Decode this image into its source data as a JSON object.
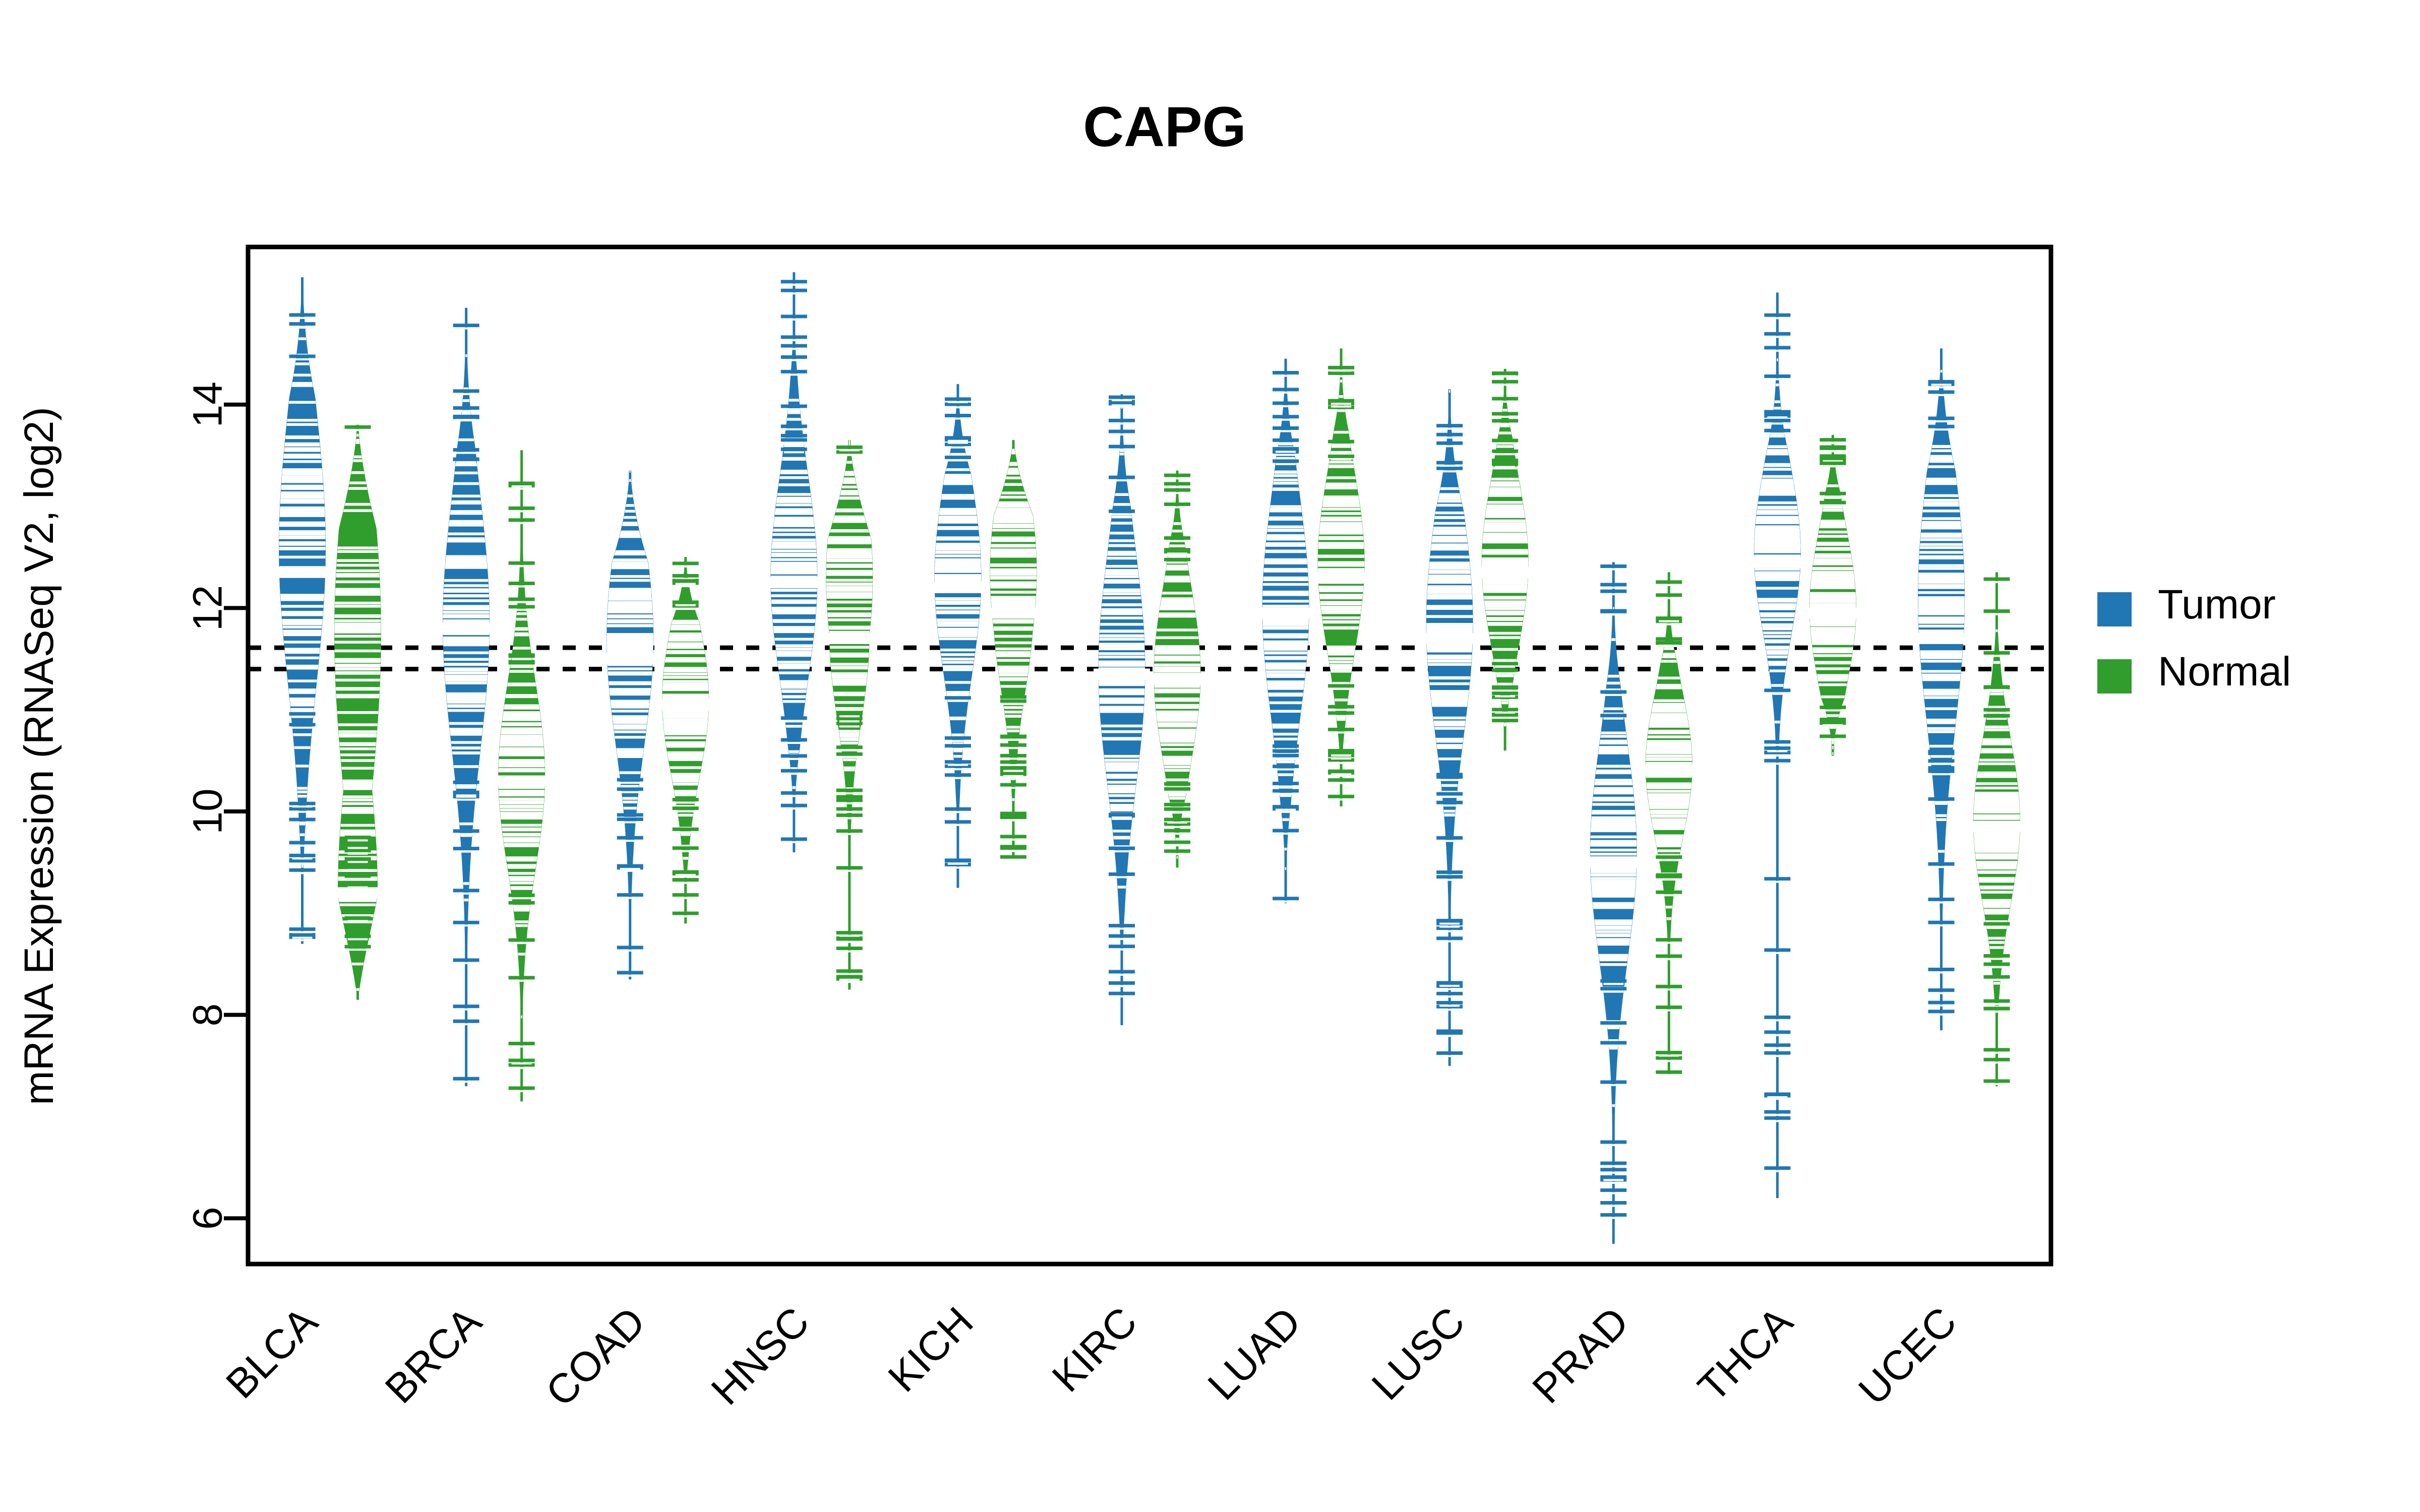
{
  "chart_data": {
    "type": "violin",
    "title": "CAPG",
    "xlabel": "",
    "ylabel": "mRNA Expression (RNASeq V2, log2)",
    "ylim": [
      5.55,
      15.55
    ],
    "yticks": [
      6,
      8,
      10,
      12,
      14
    ],
    "ytick_labels": [
      "6",
      "8",
      "10",
      "12",
      "14"
    ],
    "grid": false,
    "legend_position": "right",
    "categories": [
      "BLCA",
      "BRCA",
      "COAD",
      "HNSC",
      "KICH",
      "KIRC",
      "LUAD",
      "LUSC",
      "PRAD",
      "THCA",
      "UCEC"
    ],
    "reference_lines": [
      11.61,
      11.4
    ],
    "colors": {
      "tumor": "#2077b4",
      "normal": "#2f9e2c",
      "axis": "#000000",
      "background": "#ffffff"
    },
    "legend": [
      {
        "label": "Tumor",
        "color": "#2077b4"
      },
      {
        "label": "Normal",
        "color": "#2f9e2c"
      }
    ],
    "series": [
      {
        "name": "Tumor",
        "color": "#2077b4",
        "groups": [
          {
            "category": "BLCA",
            "median": 12.35,
            "min": 8.7,
            "max": 15.25,
            "q1": 11.45,
            "q3": 13.15,
            "peak": 12.6,
            "spread": 1.35
          },
          {
            "category": "BRCA",
            "median": 11.8,
            "min": 7.3,
            "max": 14.95,
            "q1": 10.95,
            "q3": 12.75,
            "peak": 11.85,
            "spread": 1.25
          },
          {
            "category": "COAD",
            "median": 11.5,
            "min": 8.35,
            "max": 13.35,
            "q1": 10.85,
            "q3": 12.25,
            "peak": 11.7,
            "spread": 1.05
          },
          {
            "category": "HNSC",
            "median": 12.25,
            "min": 9.6,
            "max": 15.3,
            "q1": 11.6,
            "q3": 12.95,
            "peak": 12.3,
            "spread": 1.0
          },
          {
            "category": "KICH",
            "median": 12.2,
            "min": 9.25,
            "max": 14.2,
            "q1": 11.45,
            "q3": 12.8,
            "peak": 12.3,
            "spread": 0.95
          },
          {
            "category": "KIRC",
            "median": 11.35,
            "min": 7.9,
            "max": 14.1,
            "q1": 10.6,
            "q3": 12.2,
            "peak": 11.4,
            "spread": 1.15
          },
          {
            "category": "LUAD",
            "median": 11.95,
            "min": 9.1,
            "max": 14.45,
            "q1": 11.25,
            "q3": 12.75,
            "peak": 12.0,
            "spread": 1.1
          },
          {
            "category": "LUSC",
            "median": 11.7,
            "min": 7.5,
            "max": 14.15,
            "q1": 11.0,
            "q3": 12.55,
            "peak": 11.85,
            "spread": 1.1
          },
          {
            "category": "PRAD",
            "median": 9.5,
            "min": 5.75,
            "max": 12.45,
            "q1": 8.75,
            "q3": 10.25,
            "peak": 9.6,
            "spread": 1.05
          },
          {
            "category": "THCA",
            "median": 12.45,
            "min": 6.2,
            "max": 15.1,
            "q1": 11.9,
            "q3": 13.05,
            "peak": 12.55,
            "spread": 0.8
          },
          {
            "category": "UCEC",
            "median": 11.7,
            "min": 7.85,
            "max": 14.55,
            "q1": 10.3,
            "q3": 12.55,
            "peak": 12.1,
            "spread": 1.25
          }
        ]
      },
      {
        "name": "Normal",
        "color": "#2f9e2c",
        "groups": [
          {
            "category": "BLCA",
            "median": 9.2,
            "min": 8.15,
            "max": 13.8,
            "q1": 8.85,
            "q3": 12.05,
            "peak": 11.75,
            "spread": 1.55
          },
          {
            "category": "BRCA",
            "median": 10.3,
            "min": 7.15,
            "max": 13.55,
            "q1": 9.8,
            "q3": 10.95,
            "peak": 10.35,
            "spread": 0.9
          },
          {
            "category": "COAD",
            "median": 11.05,
            "min": 8.9,
            "max": 12.5,
            "q1": 10.5,
            "q3": 11.55,
            "peak": 11.1,
            "spread": 0.75
          },
          {
            "category": "HNSC",
            "median": 11.7,
            "min": 8.25,
            "max": 13.65,
            "q1": 11.1,
            "q3": 12.6,
            "peak": 12.3,
            "spread": 1.0
          },
          {
            "category": "KICH",
            "median": 11.95,
            "min": 9.55,
            "max": 13.65,
            "q1": 11.25,
            "q3": 12.6,
            "peak": 12.35,
            "spread": 0.95
          },
          {
            "category": "KIRC",
            "median": 11.3,
            "min": 9.45,
            "max": 13.35,
            "q1": 10.8,
            "q3": 11.95,
            "peak": 11.35,
            "spread": 0.85
          },
          {
            "category": "LUAD",
            "median": 12.3,
            "min": 10.05,
            "max": 14.55,
            "q1": 11.75,
            "q3": 12.9,
            "peak": 12.45,
            "spread": 0.85
          },
          {
            "category": "LUSC",
            "median": 12.35,
            "min": 10.6,
            "max": 14.35,
            "q1": 11.85,
            "q3": 12.85,
            "peak": 12.45,
            "spread": 0.8
          },
          {
            "category": "PRAD",
            "median": 10.4,
            "min": 7.4,
            "max": 12.35,
            "q1": 10.0,
            "q3": 10.9,
            "peak": 10.45,
            "spread": 0.7
          },
          {
            "category": "THCA",
            "median": 11.95,
            "min": 10.55,
            "max": 13.7,
            "q1": 11.5,
            "q3": 12.45,
            "peak": 12.0,
            "spread": 0.75
          },
          {
            "category": "UCEC",
            "median": 9.85,
            "min": 7.3,
            "max": 12.35,
            "q1": 9.55,
            "q3": 10.4,
            "peak": 9.9,
            "spread": 0.8
          }
        ]
      }
    ]
  },
  "title": {
    "text": "CAPG"
  },
  "axes": {
    "y_label": "mRNA Expression (RNASeq V2, log2)",
    "y_ticks": [
      "6",
      "8",
      "10",
      "12",
      "14"
    ],
    "x_ticks": [
      "BLCA",
      "BRCA",
      "COAD",
      "HNSC",
      "KICH",
      "KIRC",
      "LUAD",
      "LUSC",
      "PRAD",
      "THCA",
      "UCEC"
    ]
  },
  "legend": {
    "items": [
      {
        "label": "Tumor",
        "color": "#2077b4"
      },
      {
        "label": "Normal",
        "color": "#2f9e2c"
      }
    ]
  }
}
